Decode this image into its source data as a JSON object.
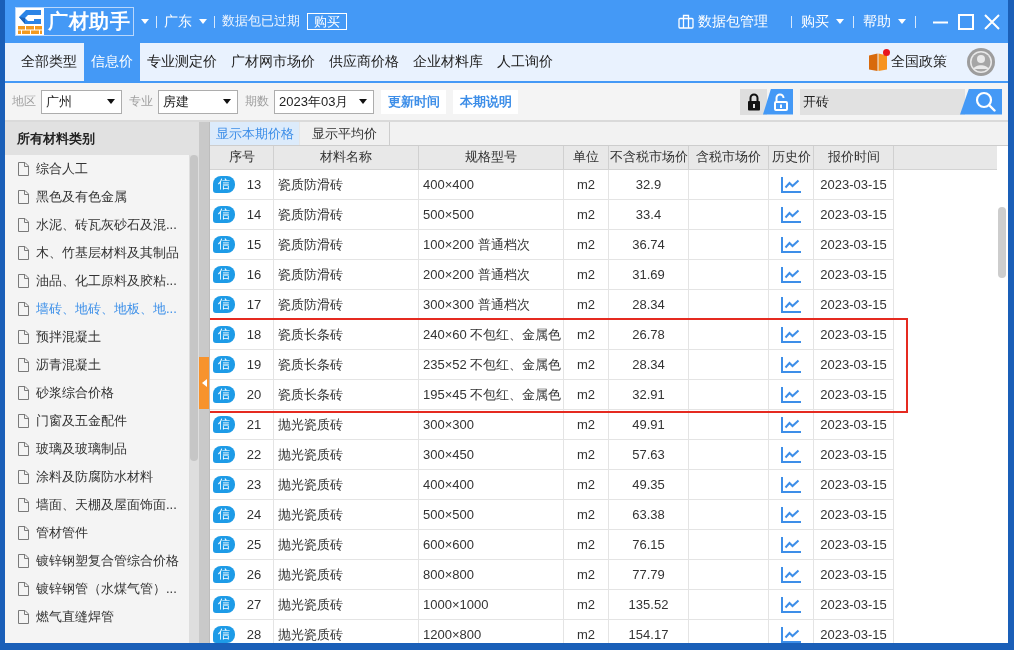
{
  "title_bar": {
    "app_name": "广材助手",
    "region": "广东",
    "notice": "数据包已过期",
    "buy_button": "购买",
    "package_manager": "数据包管理",
    "menus": [
      {
        "label": "购买"
      },
      {
        "label": "帮助"
      }
    ]
  },
  "nav_tabs": [
    {
      "label": "全部类型",
      "selected": false
    },
    {
      "label": "信息价",
      "selected": true
    },
    {
      "label": "专业测定价",
      "selected": false
    },
    {
      "label": "广材网市场价",
      "selected": false
    },
    {
      "label": "供应商价格",
      "selected": false
    },
    {
      "label": "企业材料库",
      "selected": false
    },
    {
      "label": "人工询价",
      "selected": false
    }
  ],
  "policy": {
    "label": "全国政策",
    "unread": true
  },
  "filters": [
    {
      "label": "地区",
      "value": "广州"
    },
    {
      "label": "专业",
      "value": "房建"
    },
    {
      "label": "期数",
      "value": "2023年03月"
    }
  ],
  "filter_buttons": [
    "更新时间",
    "本期说明"
  ],
  "lock_toggle": [
    {
      "kind": "locked",
      "selected": false
    },
    {
      "kind": "unlocked",
      "selected": true
    }
  ],
  "search": {
    "value": "开砖"
  },
  "sidebar": {
    "title": "所有材料类别",
    "items": [
      {
        "label": "综合人工",
        "selected": false
      },
      {
        "label": "黑色及有色金属",
        "selected": false
      },
      {
        "label": "水泥、砖瓦灰砂石及混...",
        "selected": false
      },
      {
        "label": "木、竹基层材料及其制品",
        "selected": false
      },
      {
        "label": "油品、化工原料及胶粘...",
        "selected": false
      },
      {
        "label": "墙砖、地砖、地板、地...",
        "selected": true
      },
      {
        "label": "预拌混凝土",
        "selected": false
      },
      {
        "label": "沥青混凝土",
        "selected": false
      },
      {
        "label": "砂浆综合价格",
        "selected": false
      },
      {
        "label": "门窗及五金配件",
        "selected": false
      },
      {
        "label": "玻璃及玻璃制品",
        "selected": false
      },
      {
        "label": "涂料及防腐防水材料",
        "selected": false
      },
      {
        "label": "墙面、天棚及屋面饰面...",
        "selected": false
      },
      {
        "label": "管材管件",
        "selected": false
      },
      {
        "label": "镀锌钢塑复合管综合价格",
        "selected": false
      },
      {
        "label": "镀锌钢管（水煤气管）...",
        "selected": false
      },
      {
        "label": "燃气直缝焊管",
        "selected": false
      }
    ]
  },
  "view_tabs": [
    {
      "label": "显示本期价格",
      "selected": true
    },
    {
      "label": "显示平均价",
      "selected": false
    }
  ],
  "table": {
    "columns": [
      "序号",
      "材料名称",
      "规格型号",
      "单位",
      "不含税市场价",
      "含税市场价",
      "历史价",
      "报价时间"
    ],
    "rows": [
      {
        "badge": "信",
        "number": "13",
        "name": "瓷质防滑砖",
        "spec": "400×400",
        "unit": "m2",
        "price_ex_tax": "32.9",
        "date": "2023-03-15",
        "highlighted": false
      },
      {
        "badge": "信",
        "number": "14",
        "name": "瓷质防滑砖",
        "spec": "500×500",
        "unit": "m2",
        "price_ex_tax": "33.4",
        "date": "2023-03-15",
        "highlighted": false
      },
      {
        "badge": "信",
        "number": "15",
        "name": "瓷质防滑砖",
        "spec": "100×200 普通档次",
        "unit": "m2",
        "price_ex_tax": "36.74",
        "date": "2023-03-15",
        "highlighted": false
      },
      {
        "badge": "信",
        "number": "16",
        "name": "瓷质防滑砖",
        "spec": "200×200 普通档次",
        "unit": "m2",
        "price_ex_tax": "31.69",
        "date": "2023-03-15",
        "highlighted": false
      },
      {
        "badge": "信",
        "number": "17",
        "name": "瓷质防滑砖",
        "spec": "300×300 普通档次",
        "unit": "m2",
        "price_ex_tax": "28.34",
        "date": "2023-03-15",
        "highlighted": false
      },
      {
        "badge": "信",
        "number": "18",
        "name": "瓷质长条砖",
        "spec": "240×60 不包红、金属色",
        "unit": "m2",
        "price_ex_tax": "26.78",
        "date": "2023-03-15",
        "highlighted": true
      },
      {
        "badge": "信",
        "number": "19",
        "name": "瓷质长条砖",
        "spec": "235×52 不包红、金属色",
        "unit": "m2",
        "price_ex_tax": "28.34",
        "date": "2023-03-15",
        "highlighted": true
      },
      {
        "badge": "信",
        "number": "20",
        "name": "瓷质长条砖",
        "spec": "195×45 不包红、金属色",
        "unit": "m2",
        "price_ex_tax": "32.91",
        "date": "2023-03-15",
        "highlighted": true
      },
      {
        "badge": "信",
        "number": "21",
        "name": "抛光瓷质砖",
        "spec": "300×300",
        "unit": "m2",
        "price_ex_tax": "49.91",
        "date": "2023-03-15",
        "highlighted": false
      },
      {
        "badge": "信",
        "number": "22",
        "name": "抛光瓷质砖",
        "spec": "300×450",
        "unit": "m2",
        "price_ex_tax": "57.63",
        "date": "2023-03-15",
        "highlighted": false
      },
      {
        "badge": "信",
        "number": "23",
        "name": "抛光瓷质砖",
        "spec": "400×400",
        "unit": "m2",
        "price_ex_tax": "49.35",
        "date": "2023-03-15",
        "highlighted": false
      },
      {
        "badge": "信",
        "number": "24",
        "name": "抛光瓷质砖",
        "spec": "500×500",
        "unit": "m2",
        "price_ex_tax": "63.38",
        "date": "2023-03-15",
        "highlighted": false
      },
      {
        "badge": "信",
        "number": "25",
        "name": "抛光瓷质砖",
        "spec": "600×600",
        "unit": "m2",
        "price_ex_tax": "76.15",
        "date": "2023-03-15",
        "highlighted": false
      },
      {
        "badge": "信",
        "number": "26",
        "name": "抛光瓷质砖",
        "spec": "800×800",
        "unit": "m2",
        "price_ex_tax": "77.79",
        "date": "2023-03-15",
        "highlighted": false
      },
      {
        "badge": "信",
        "number": "27",
        "name": "抛光瓷质砖",
        "spec": "1000×1000",
        "unit": "m2",
        "price_ex_tax": "135.52",
        "date": "2023-03-15",
        "highlighted": false
      },
      {
        "badge": "信",
        "number": "28",
        "name": "抛光瓷质砖",
        "spec": "1200×800",
        "unit": "m2",
        "price_ex_tax": "154.17",
        "date": "2023-03-15",
        "highlighted": false
      }
    ]
  }
}
